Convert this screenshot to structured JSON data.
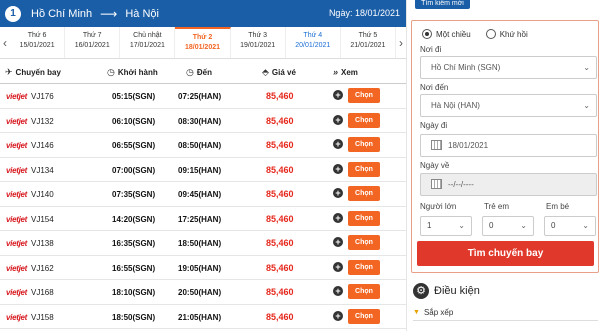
{
  "route": {
    "step": "1",
    "from": "Hồ Chí Minh",
    "to": "Hà Nội",
    "date": "Ngày: 18/01/2021"
  },
  "days": [
    {
      "name": "Thứ 6",
      "date": "15/01/2021"
    },
    {
      "name": "Thứ 7",
      "date": "16/01/2021"
    },
    {
      "name": "Chủ nhật",
      "date": "17/01/2021"
    },
    {
      "name": "Thứ 2",
      "date": "18/01/2021"
    },
    {
      "name": "Thứ 3",
      "date": "19/01/2021"
    },
    {
      "name": "Thứ 4",
      "date": "20/01/2021"
    },
    {
      "name": "Thứ 5",
      "date": "21/01/2021"
    }
  ],
  "columns": {
    "flight": "Chuyến bay",
    "depart": "Khởi hành",
    "arrive": "Đến",
    "price": "Giá vé",
    "view": "Xem"
  },
  "airline_logo": "vietjet",
  "choose_label": "Chọn",
  "flights": [
    {
      "no": "VJ176",
      "dep": "05:15(SGN)",
      "arr": "07:25(HAN)",
      "price": "85,460"
    },
    {
      "no": "VJ132",
      "dep": "06:10(SGN)",
      "arr": "08:30(HAN)",
      "price": "85,460"
    },
    {
      "no": "VJ146",
      "dep": "06:55(SGN)",
      "arr": "08:50(HAN)",
      "price": "85,460"
    },
    {
      "no": "VJ134",
      "dep": "07:00(SGN)",
      "arr": "09:15(HAN)",
      "price": "85,460"
    },
    {
      "no": "VJ140",
      "dep": "07:35(SGN)",
      "arr": "09:45(HAN)",
      "price": "85,460"
    },
    {
      "no": "VJ154",
      "dep": "14:20(SGN)",
      "arr": "17:25(HAN)",
      "price": "85,460"
    },
    {
      "no": "VJ138",
      "dep": "16:35(SGN)",
      "arr": "18:50(HAN)",
      "price": "85,460"
    },
    {
      "no": "VJ162",
      "dep": "16:55(SGN)",
      "arr": "19:05(HAN)",
      "price": "85,460"
    },
    {
      "no": "VJ168",
      "dep": "18:10(SGN)",
      "arr": "20:50(HAN)",
      "price": "85,460"
    },
    {
      "no": "VJ158",
      "dep": "18:50(SGN)",
      "arr": "21:05(HAN)",
      "price": "85,460"
    }
  ],
  "search": {
    "tab_label": "Tìm kiếm mới",
    "one_way": "Một chiều",
    "round_trip": "Khứ hồi",
    "from_label": "Nơi đi",
    "from_value": "Hồ Chí Minh (SGN)",
    "to_label": "Nơi đến",
    "to_value": "Hà Nội (HAN)",
    "depart_label": "Ngày đi",
    "depart_value": "18/01/2021",
    "return_label": "Ngày về",
    "return_value": "--/--/----",
    "adult_label": "Người lớn",
    "adult_value": "1",
    "child_label": "Trẻ em",
    "child_value": "0",
    "infant_label": "Em bé",
    "infant_value": "0",
    "button": "Tìm chuyến bay"
  },
  "conditions": {
    "title": "Điều kiện",
    "sort": "Sắp xếp"
  }
}
